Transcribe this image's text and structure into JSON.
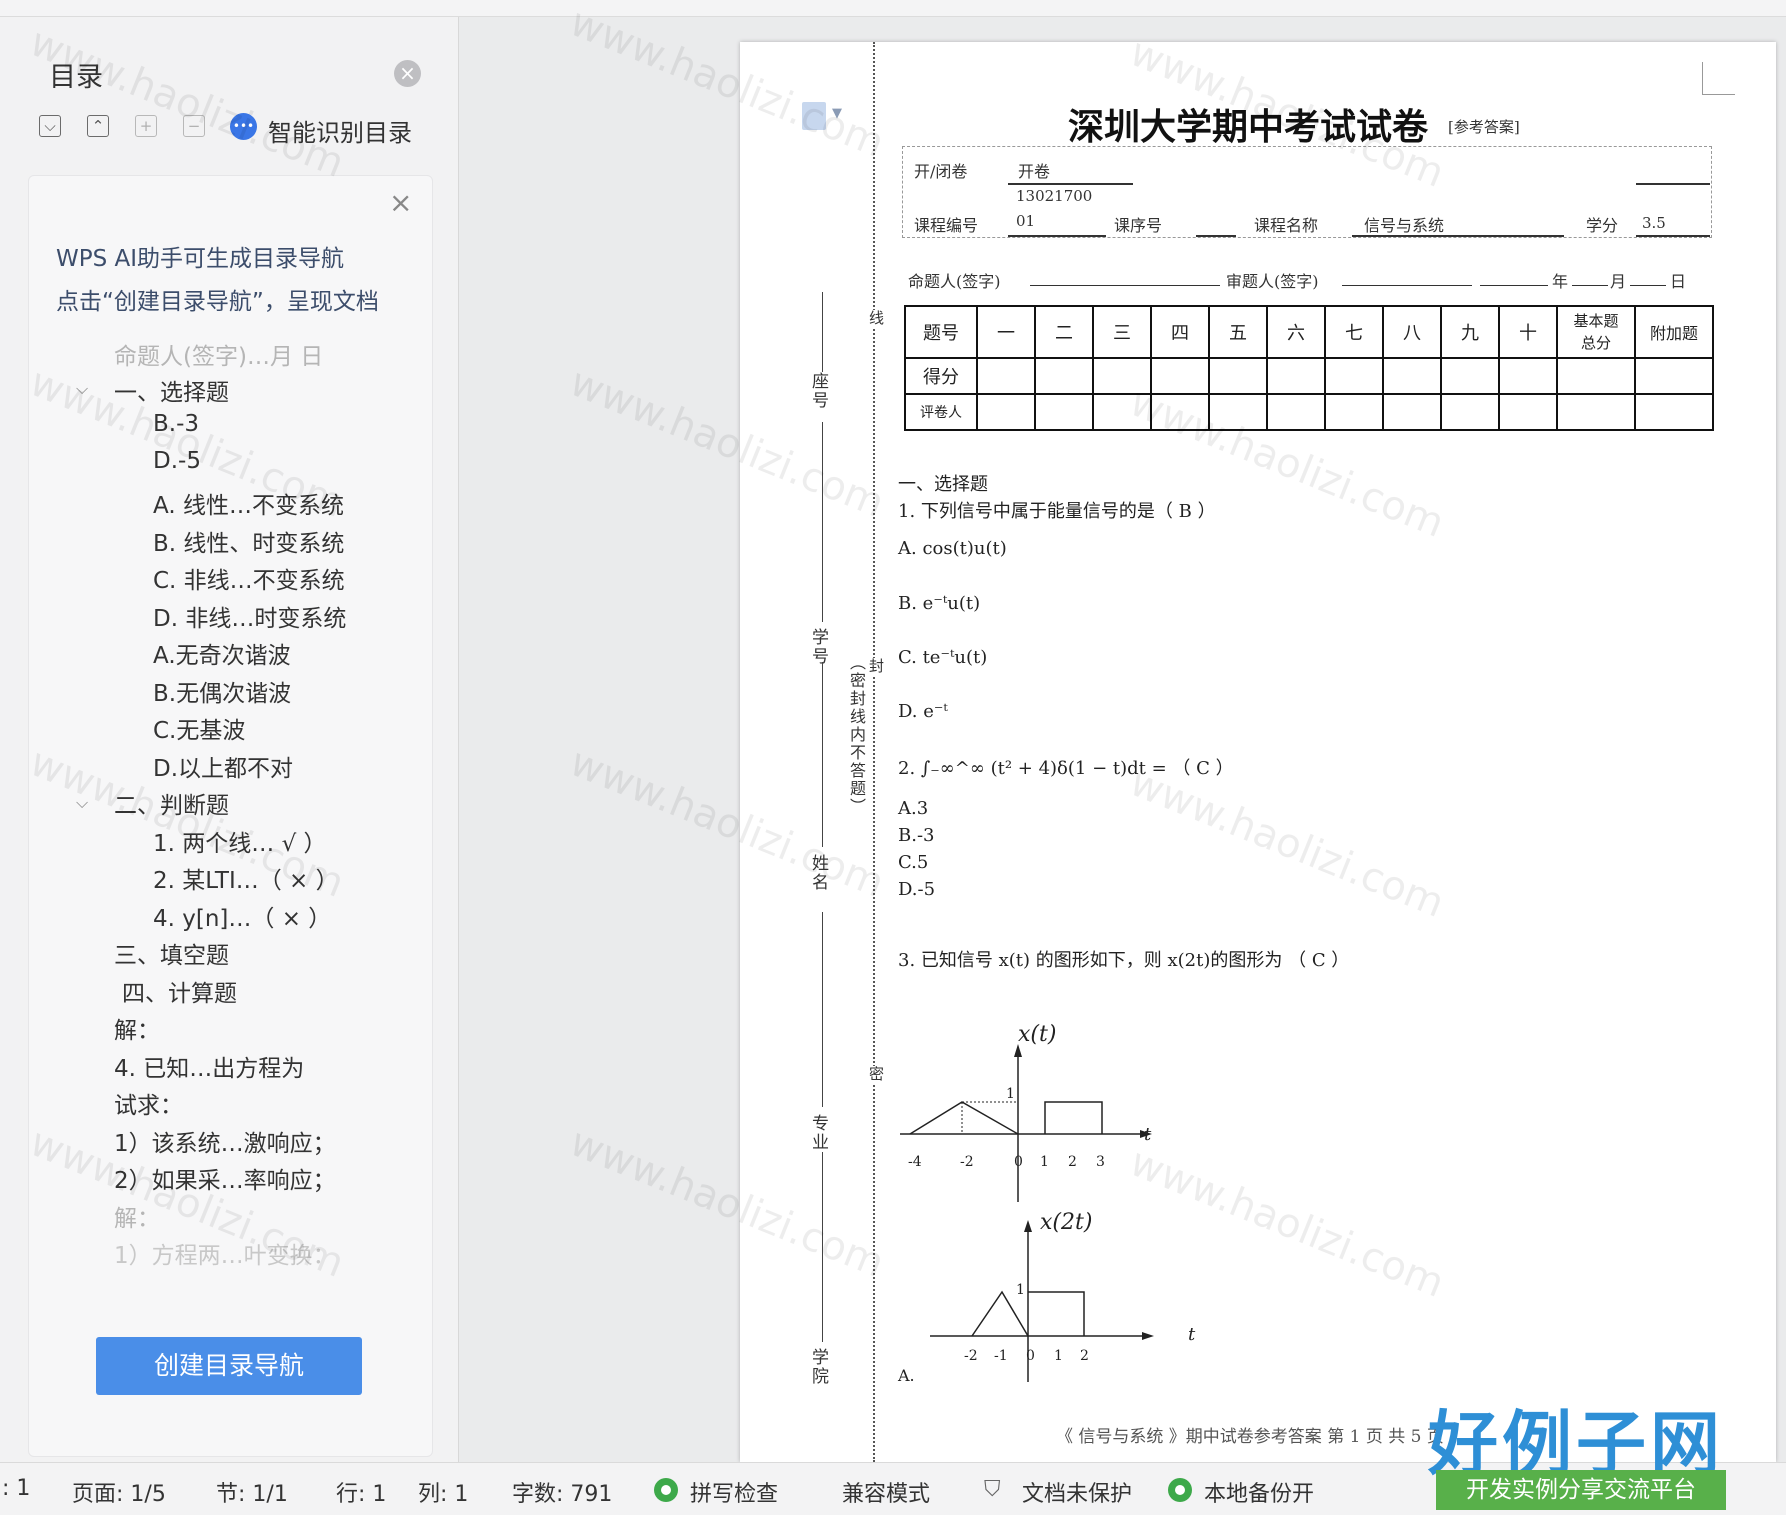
{
  "sidebar": {
    "title": "目录",
    "close_icon": "×",
    "toolbar": {
      "expand": "⌵",
      "collapse": "⌃",
      "add": "+",
      "remove": "−"
    },
    "ai_label": "智能识别目录",
    "panel": {
      "close": "×",
      "hint_line1": "WPS AI助手可生成目录导航",
      "hint_line2": "点击“创建目录导航”，呈现文档",
      "items": [
        "命题人(签字)…月    日",
        "一、选择题",
        "B.-3",
        "D.-5",
        "A. 线性…不变系统",
        "B. 线性、时变系统",
        "C. 非线…不变系统",
        "D. 非线…时变系统",
        "A.无奇次谐波",
        "B.无偶次谐波",
        "C.无基波",
        "D.以上都不对",
        "二、判断题",
        "1. 两个线… √ ）",
        "2. 某LTI…（ × ）",
        "4. y[n]…（ × ）",
        "三、填空题",
        "四、计算题",
        "解：",
        "4. 已知…出方程为",
        "试求：",
        "1）该系统…激响应；",
        "2）如果采…率响应；",
        "解：",
        "1）方程两…叶变换："
      ],
      "create_button": "创建目录导航"
    }
  },
  "document": {
    "title": "深圳大学期中考试试卷",
    "title_suffix": "[参考答案]",
    "vertical": {
      "seat": "座号",
      "student_id": "学号",
      "name": "姓名",
      "major": "专业",
      "college": "学院",
      "seal_note": "（密封线内不答题）",
      "line": "线",
      "seal": "封",
      "secret": "密"
    },
    "info": {
      "open_closed_label": "开/闭卷",
      "open_closed_value": "开卷",
      "course_code_label": "课程编号",
      "course_code_value_1": "13021700",
      "course_code_value_2": "01",
      "course_seq_label": "课序号",
      "course_name_label": "课程名称",
      "course_name_value": "信号与系统",
      "credit_label": "学分",
      "credit_value": "3.5",
      "setter_label": "命题人(签字)",
      "reviewer_label": "审题人(签字)",
      "year": "年",
      "month": "月",
      "day": "日"
    },
    "score_table": {
      "header": [
        "题号",
        "一",
        "二",
        "三",
        "四",
        "五",
        "六",
        "七",
        "八",
        "九",
        "十",
        "基本题\n总分",
        "附加题"
      ],
      "row_score": "得分",
      "row_grader": "评卷人"
    },
    "questions": {
      "section1": "一、选择题",
      "q1": "1.  下列信号中属于能量信号的是（    B    ）",
      "q1_a": "A. cos(t)u(t)",
      "q1_b": "B. e⁻ᵗu(t)",
      "q1_c": "C. te⁻ᵗu(t)",
      "q1_d": "D. e⁻ᵗ",
      "q2": "2.   ∫₋∞^∞ (t² + 4)δ(1 − t)dt = （    C    ）",
      "q2_a": "A.3",
      "q2_b": "B.-3",
      "q2_c": "C.5",
      "q2_d": "D.-5",
      "q3": "3.  已知信号 x(t) 的图形如下，则 x(2t)的图形为 （    C    ）",
      "fig1_label": "x(t)",
      "fig1_ticks": [
        "-4",
        "-2",
        "0",
        "1",
        "2",
        "3"
      ],
      "fig1_one": "1",
      "fig1_t": "t",
      "fig2_label": "x(2t)",
      "fig2_ticks": [
        "-2",
        "-1",
        "0",
        "1",
        "2"
      ],
      "fig2_one": "1",
      "fig2_t": "t",
      "fig2_option": "A."
    },
    "footer": "《 信号与系统 》期中试卷参考答案    第  1  页   共  5  页"
  },
  "status_bar": {
    "col_prefix": ": 1",
    "page": "页面: 1/5",
    "section": "节: 1/1",
    "row": "行: 1",
    "col": "列: 1",
    "words": "字数: 791",
    "spell": "拼写检查",
    "compat": "兼容模式",
    "protect": "文档未保护",
    "backup": "本地备份开"
  },
  "watermark": {
    "brand": "好例子网",
    "brand_sub": "开发实例分享交流平台",
    "site": "www.haolizi.com"
  }
}
